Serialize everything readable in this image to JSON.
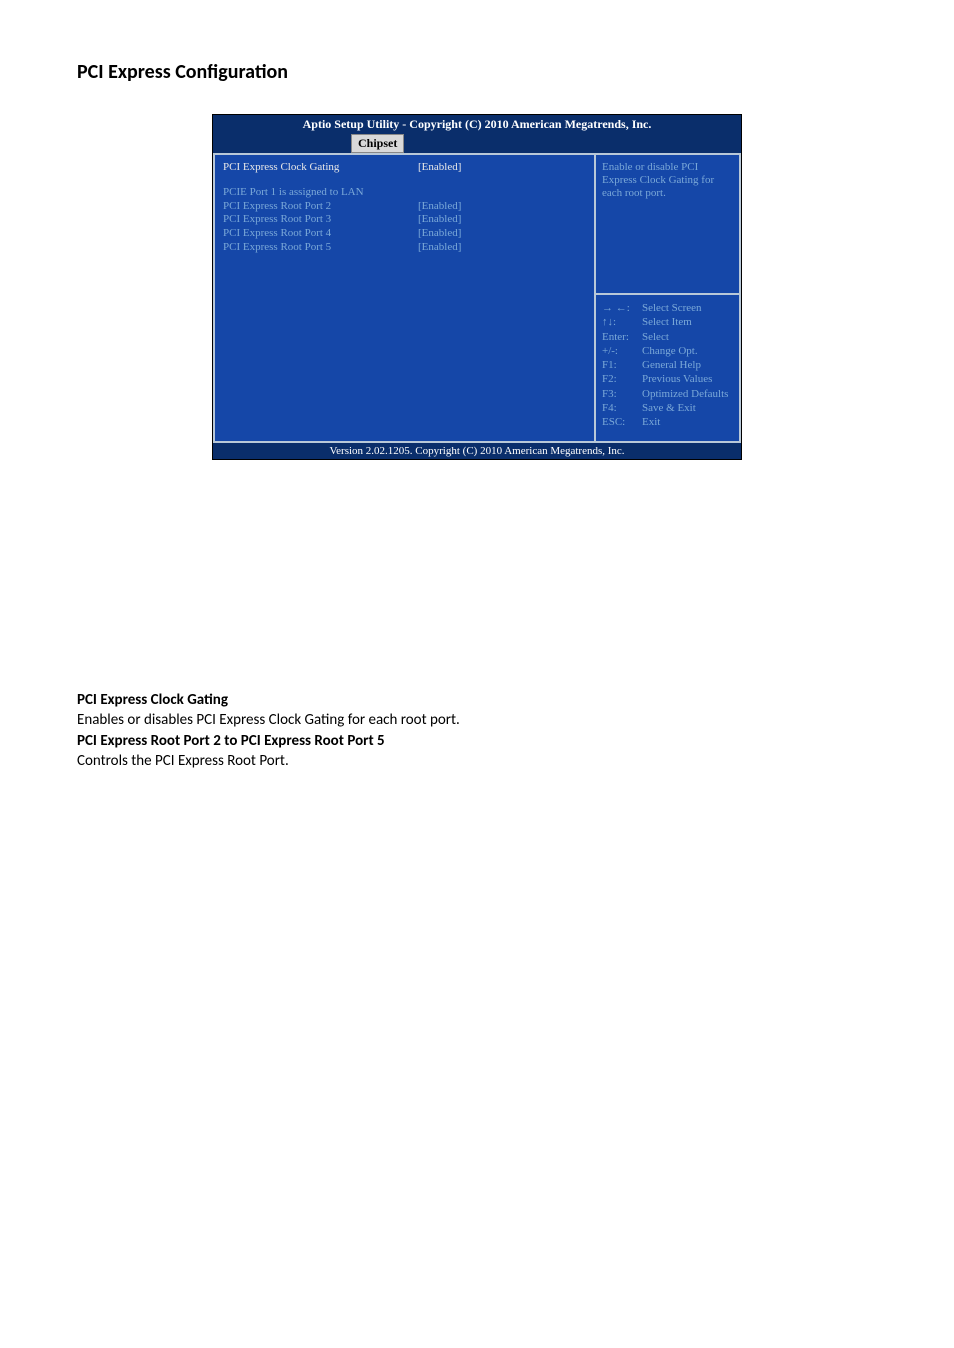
{
  "page": {
    "title": "PCI Express Configuration"
  },
  "bios": {
    "header": "Aptio Setup Utility - Copyright (C) 2010 American Megatrends, Inc.",
    "tab": "Chipset",
    "settings": [
      {
        "label": "PCI Express Clock Gating",
        "value": "[Enabled]",
        "selected": true
      },
      {
        "label": "PCIE Port 1 is assigned to LAN",
        "value": "",
        "selected": false
      },
      {
        "label": "PCI Express Root Port 2",
        "value": "[Enabled]",
        "selected": false
      },
      {
        "label": "PCI Express Root Port 3",
        "value": "[Enabled]",
        "selected": false
      },
      {
        "label": "PCI Express Root Port 4",
        "value": "[Enabled]",
        "selected": false
      },
      {
        "label": "PCI Express Root Port 5",
        "value": "[Enabled]",
        "selected": false
      }
    ],
    "help_text": "Enable or disable PCI Express Clock Gating for each root port.",
    "keys": [
      {
        "key": "→ ←:",
        "action": "Select Screen"
      },
      {
        "key": "↑↓:",
        "action": "Select Item"
      },
      {
        "key": "Enter:",
        "action": "Select"
      },
      {
        "key": "+/-:",
        "action": "Change Opt."
      },
      {
        "key": "F1:",
        "action": "General Help"
      },
      {
        "key": "F2:",
        "action": "Previous Values"
      },
      {
        "key": "F3:",
        "action": "Optimized Defaults"
      },
      {
        "key": "F4:",
        "action": "Save & Exit"
      },
      {
        "key": "ESC:",
        "action": "Exit"
      }
    ],
    "footer": "Version 2.02.1205. Copyright (C) 2010 American Megatrends, Inc."
  },
  "doc": {
    "heading1": "PCI Express Clock Gating",
    "text1": "Enables or disables PCI Express Clock Gating for each root port.",
    "heading2": "PCI Express Root Port 2 to PCI Express Root Port 5",
    "text2": "Controls the PCI Express Root Port."
  }
}
